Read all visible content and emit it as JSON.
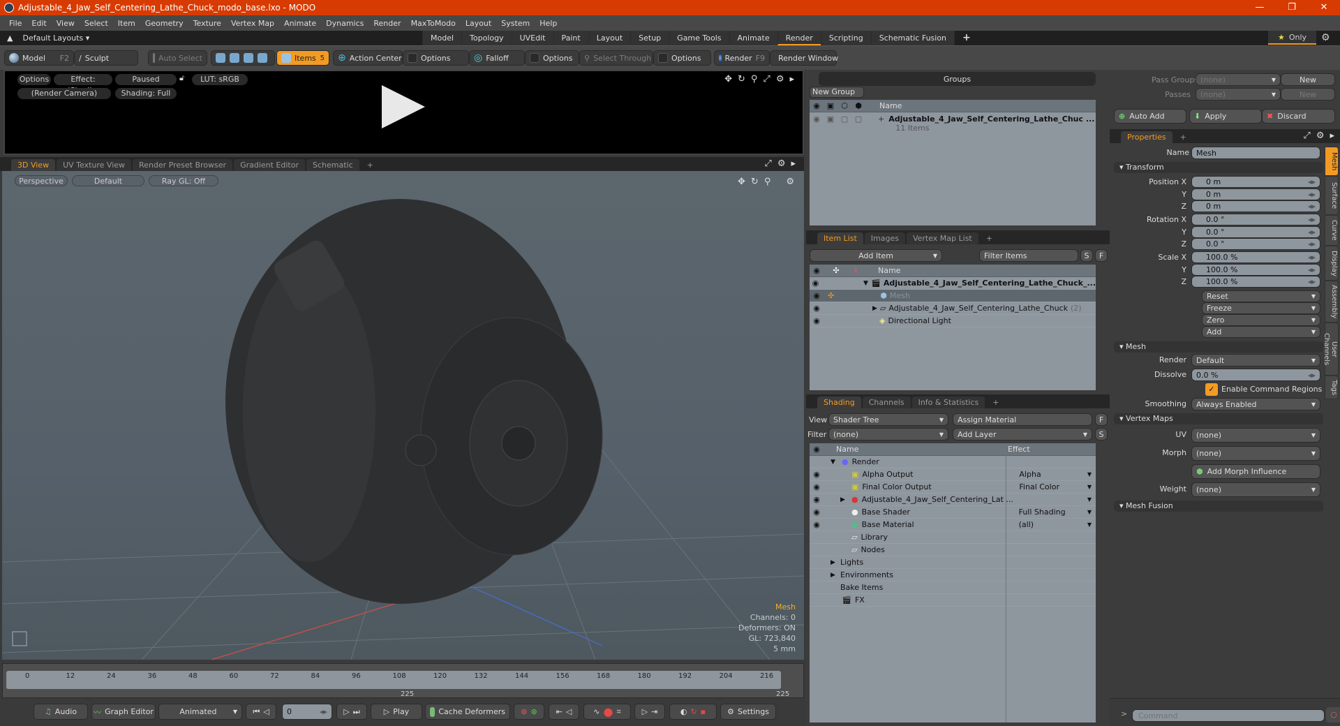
{
  "window": {
    "title": "Adjustable_4_Jaw_Self_Centering_Lathe_Chuck_modo_base.lxo - MODO",
    "minimize": "—",
    "restore": "❐",
    "close": "✕"
  },
  "menu": [
    "File",
    "Edit",
    "View",
    "Select",
    "Item",
    "Geometry",
    "Texture",
    "Vertex Map",
    "Animate",
    "Dynamics",
    "Render",
    "MaxToModo",
    "Layout",
    "System",
    "Help"
  ],
  "layouts": {
    "label": "Default Layouts ▾",
    "tabs": [
      "Model",
      "Topology",
      "UVEdit",
      "Paint",
      "Layout",
      "Setup",
      "Game Tools",
      "Animate",
      "Render",
      "Scripting",
      "Schematic Fusion"
    ],
    "active": "Render",
    "add": "+",
    "only": "Only"
  },
  "toolbar": {
    "model": "Model",
    "model_key": "F2",
    "sculpt": "Sculpt",
    "auto_select": "Auto Select",
    "items": "Items",
    "items_count": "5",
    "action_center": "Action Center",
    "options": "Options",
    "falloff": "Falloff",
    "select_through": "Select Through",
    "render": "Render",
    "render_key": "F9",
    "render_window": "Render Window"
  },
  "preview": {
    "options": "Options",
    "effect": "Effect: (Shadi...",
    "paused": "Paused",
    "lut": "LUT: sRGB",
    "camera": "(Render Camera)",
    "shading": "Shading: Full"
  },
  "viewport": {
    "tabs": [
      "3D View",
      "UV Texture View",
      "Render Preset Browser",
      "Gradient Editor",
      "Schematic"
    ],
    "active_tab": "3D View",
    "perspective": "Perspective",
    "default": "Default",
    "raygl": "Ray GL: Off",
    "stats": {
      "type": "Mesh",
      "channels": "Channels: 0",
      "deformers": "Deformers: ON",
      "gl": "GL: 723,840",
      "unit": "5 mm"
    }
  },
  "timeline": {
    "ticks": [
      "0",
      "12",
      "24",
      "36",
      "48",
      "60",
      "72",
      "84",
      "96",
      "108",
      "120",
      "132",
      "144",
      "156",
      "168",
      "180",
      "192",
      "204",
      "216"
    ],
    "range_mid": "225",
    "range_end": "225"
  },
  "bottom": {
    "audio": "Audio",
    "graph_editor": "Graph Editor",
    "animated": "Animated",
    "frame": "0",
    "play": "Play",
    "cache_deformers": "Cache Deformers",
    "settings": "Settings"
  },
  "groups": {
    "title": "Groups",
    "new_group": "New Group",
    "col_name": "Name",
    "row_name": "Adjustable_4_Jaw_Self_Centering_Lathe_Chuc ...",
    "row_sub": "11 Items"
  },
  "itemlist": {
    "tabs": [
      "Item List",
      "Images",
      "Vertex Map List"
    ],
    "active": "Item List",
    "add_item": "Add Item",
    "filter": "Filter Items",
    "s": "S",
    "f": "F",
    "col_name": "Name",
    "rows": [
      {
        "name": "Adjustable_4_Jaw_Self_Centering_Lathe_Chuck_...",
        "bold": true
      },
      {
        "name": "Mesh",
        "dim": true
      },
      {
        "name": "Adjustable_4_Jaw_Self_Centering_Lathe_Chuck",
        "count": "(2)"
      },
      {
        "name": "Directional Light"
      }
    ]
  },
  "shading": {
    "tabs": [
      "Shading",
      "Channels",
      "Info & Statistics"
    ],
    "active": "Shading",
    "view_label": "View",
    "view_value": "Shader Tree",
    "assign_material": "Assign Material",
    "filter_label": "Filter",
    "filter_value": "(none)",
    "add_layer": "Add Layer",
    "f": "F",
    "s": "S",
    "col_name": "Name",
    "col_effect": "Effect",
    "rows": [
      {
        "name": "Render",
        "effect": "",
        "indent": 0
      },
      {
        "name": "Alpha Output",
        "effect": "Alpha",
        "indent": 1
      },
      {
        "name": "Final Color Output",
        "effect": "Final Color",
        "indent": 1
      },
      {
        "name": "Adjustable_4_Jaw_Self_Centering_Lat ...",
        "effect": "",
        "indent": 1
      },
      {
        "name": "Base Shader",
        "effect": "Full Shading",
        "indent": 1
      },
      {
        "name": "Base Material",
        "effect": "(all)",
        "indent": 1
      },
      {
        "name": "Library",
        "effect": "",
        "indent": 1
      },
      {
        "name": "Nodes",
        "effect": "",
        "indent": 1
      },
      {
        "name": "Lights",
        "effect": "",
        "indent": 0
      },
      {
        "name": "Environments",
        "effect": "",
        "indent": 0
      },
      {
        "name": "Bake Items",
        "effect": "",
        "indent": 0
      },
      {
        "name": "FX",
        "effect": "",
        "indent": 0
      }
    ]
  },
  "passes": {
    "pass_groups": "Pass Groups",
    "passes": "Passes",
    "none": "(none)",
    "new": "New",
    "auto_add": "Auto Add",
    "apply": "Apply",
    "discard": "Discard"
  },
  "properties": {
    "tab": "Properties",
    "name_label": "Name",
    "name_value": "Mesh",
    "transform": "Transform",
    "position_label": "Position X",
    "rotation_label": "Rotation X",
    "scale_label": "Scale X",
    "position": [
      "0 m",
      "0 m",
      "0 m"
    ],
    "rotation": [
      "0.0 °",
      "0.0 °",
      "0.0 °"
    ],
    "scale": [
      "100.0 %",
      "100.0 %",
      "100.0 %"
    ],
    "y": "Y",
    "z": "Z",
    "actions": [
      "Reset",
      "Freeze",
      "Zero",
      "Add"
    ],
    "mesh": "Mesh",
    "render_label": "Render",
    "render_value": "Default",
    "dissolve_label": "Dissolve",
    "dissolve_value": "0.0 %",
    "enable_cmd": "Enable Command Regions",
    "smoothing_label": "Smoothing",
    "smoothing_value": "Always Enabled",
    "vertex_maps": "Vertex Maps",
    "uv_label": "UV",
    "morph_label": "Morph",
    "weight_label": "Weight",
    "none": "(none)",
    "add_morph": "Add Morph Influence",
    "mesh_fusion": "Mesh Fusion",
    "side_tabs": [
      "Mesh",
      "Surface",
      "Curve",
      "Display",
      "Assembly",
      "User Channels",
      "Tags"
    ]
  },
  "command": {
    "prompt": ">",
    "placeholder": "Command"
  },
  "colors": {
    "accent": "#f29b24",
    "titlebar": "#d83b01"
  }
}
